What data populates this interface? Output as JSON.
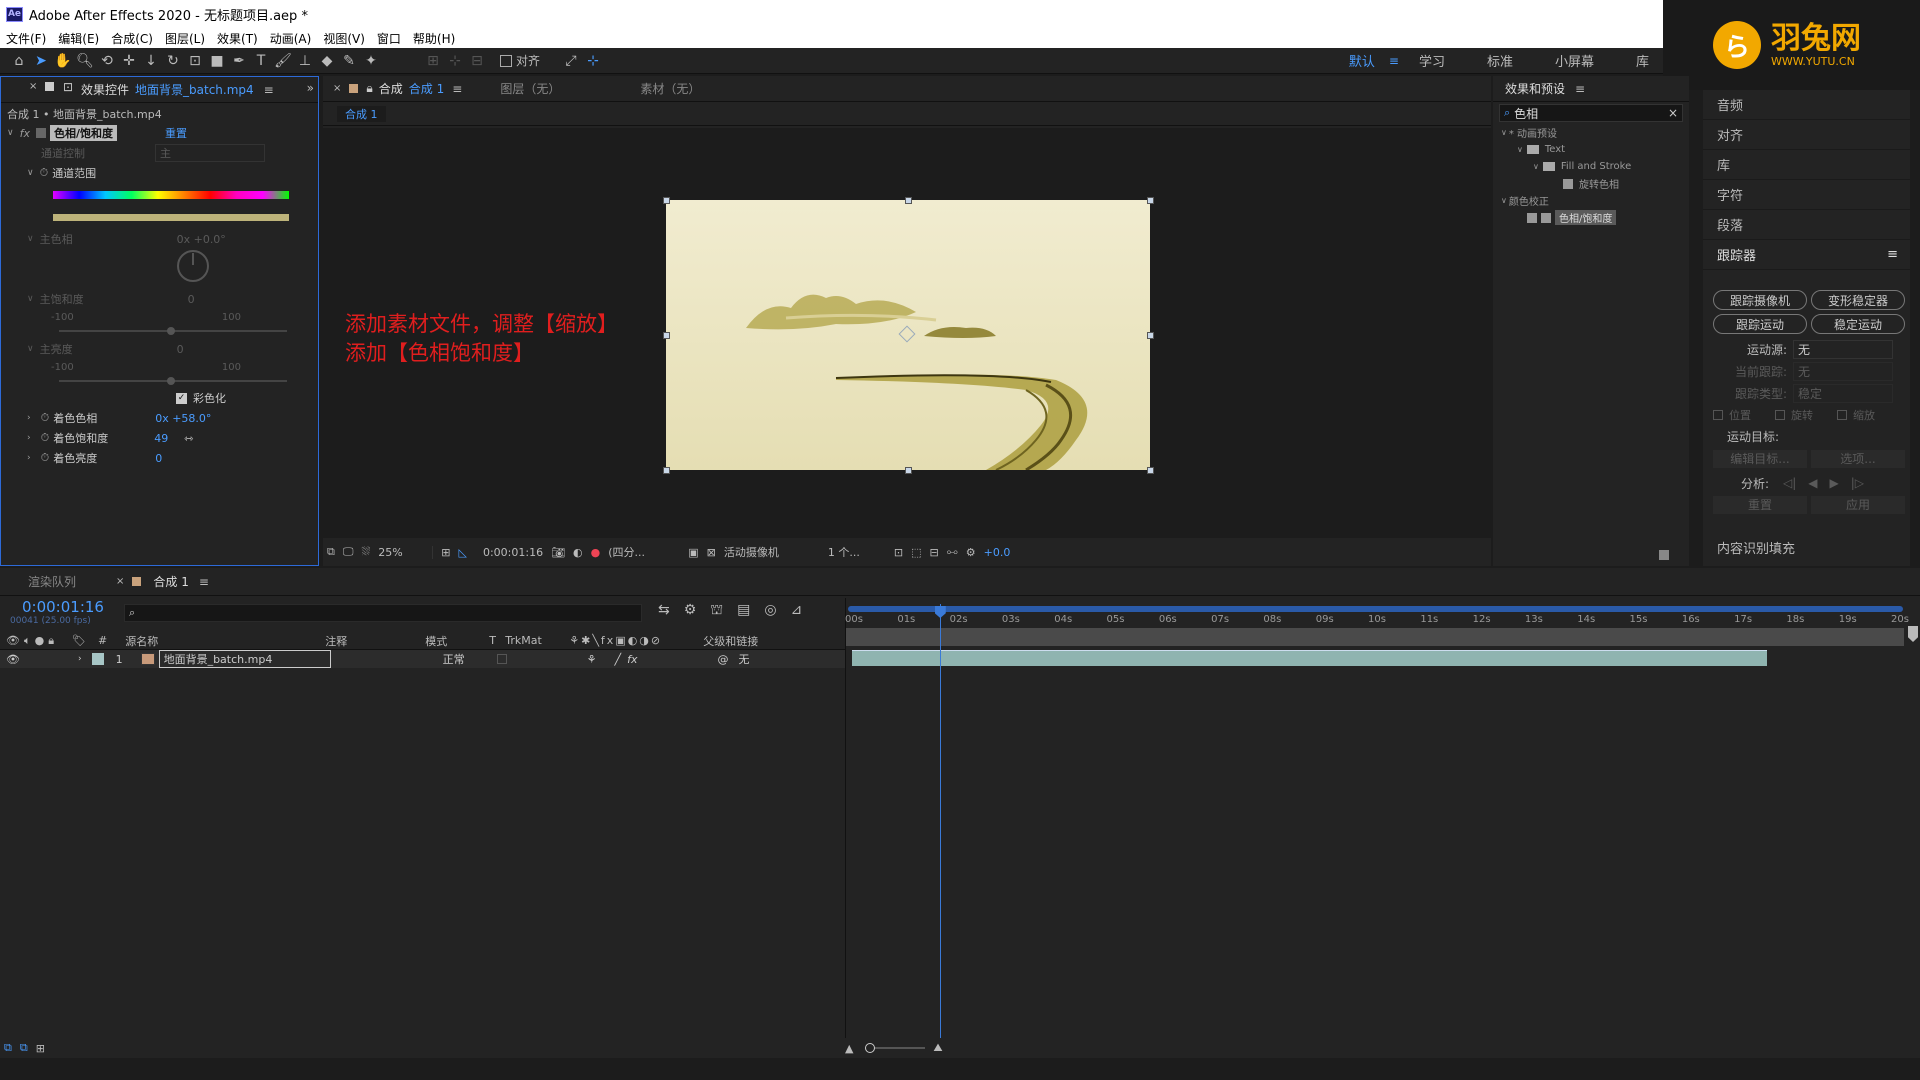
{
  "app": {
    "title": "Adobe After Effects 2020 - 无标题项目.aep *",
    "logo_glyph": "Ae"
  },
  "menu": [
    "文件(F)",
    "编辑(E)",
    "合成(C)",
    "图层(L)",
    "效果(T)",
    "动画(A)",
    "视图(V)",
    "窗口",
    "帮助(H)"
  ],
  "toolbar": {
    "align_label": "对齐",
    "workspaces": [
      "默认",
      "学习",
      "标准",
      "小屏幕",
      "库"
    ]
  },
  "brand": {
    "glyph": "ら",
    "name": "羽兔网",
    "url": "WWW.YUTU.CN",
    "color": "#f2a800"
  },
  "effect_controls": {
    "tab_label": "效果控件",
    "tab_file": "地面背景_batch.mp4",
    "breadcrumb": "合成 1 • 地面背景_batch.mp4",
    "fx_label": "fx",
    "effect_name": "色相/饱和度",
    "reset_label": "重置",
    "channel_control_label": "通道控制",
    "channel_control_value": "主",
    "channel_range_label": "通道范围",
    "master_hue_label": "主色相",
    "master_hue_value": "0x +0.0°",
    "master_sat_label": "主饱和度",
    "master_sat_value": "0",
    "master_light_label": "主亮度",
    "master_light_value": "0",
    "slider_min": "-100",
    "slider_max": "100",
    "colorize_label": "彩色化",
    "colorize_checked": true,
    "colorize_hue_label": "着色色相",
    "colorize_hue_value": "0x +58.0°",
    "colorize_sat_label": "着色饱和度",
    "colorize_sat_value": "49",
    "colorize_light_label": "着色亮度",
    "colorize_light_value": "0"
  },
  "composition": {
    "tab_prefix": "合成",
    "tab_name": "合成 1",
    "layer_tab": "图层（无）",
    "footage_tab": "素材（无）",
    "subtab": "合成 1",
    "annotation_line1": "添加素材文件，调整【缩放】",
    "annotation_line2": "添加【色相饱和度】",
    "zoom": "25%",
    "timecode": "0:00:01:16",
    "resolution": "(四分...",
    "camera": "活动摄像机",
    "views": "1 个...",
    "exposure": "+0.0"
  },
  "effects_presets": {
    "title": "效果和预设",
    "search_value": "色相",
    "tree": [
      {
        "label": "* 动画预设",
        "level": 0
      },
      {
        "label": "Text",
        "level": 1
      },
      {
        "label": "Fill and Stroke",
        "level": 2
      },
      {
        "label": "旋转色相",
        "level": 3
      },
      {
        "label": "颜色校正",
        "level": 0
      },
      {
        "label": "色相/饱和度",
        "level": 1
      }
    ]
  },
  "right_panels": {
    "items": [
      "音频",
      "对齐",
      "库",
      "字符",
      "段落"
    ],
    "tracker_title": "跟踪器",
    "track_camera": "跟踪摄像机",
    "warp_stabilizer": "变形稳定器",
    "track_motion": "跟踪运动",
    "stabilize_motion": "稳定运动",
    "motion_source_label": "运动源:",
    "motion_source_value": "无",
    "current_track_label": "当前跟踪:",
    "current_track_value": "无",
    "track_type_label": "跟踪类型:",
    "track_type_value": "稳定",
    "position_label": "位置",
    "rotation_label": "旋转",
    "scale_label": "缩放",
    "motion_target_label": "运动目标:",
    "edit_target_label": "编辑目标...",
    "options_label": "选项...",
    "analyze_label": "分析:",
    "reset_label": "重置",
    "apply_label": "应用",
    "content_fill": "内容识别填充"
  },
  "timeline": {
    "render_queue_tab": "渲染队列",
    "comp_tab": "合成 1",
    "timecode": "0:00:01:16",
    "frame_info": "00041 (25.00 fps)",
    "search_placeholder": "",
    "col_num": "#",
    "col_source": "源名称",
    "col_comment": "注释",
    "col_mode": "模式",
    "col_t": "T",
    "col_trkmat": "TrkMat",
    "col_parent": "父级和链接",
    "ruler": [
      "00s",
      "01s",
      "02s",
      "03s",
      "04s",
      "05s",
      "06s",
      "07s",
      "08s",
      "09s",
      "10s",
      "11s",
      "12s",
      "13s",
      "14s",
      "15s",
      "16s",
      "17s",
      "18s",
      "19s",
      "20s"
    ],
    "layer": {
      "num": "1",
      "name": "地面背景_batch.mp4",
      "mode": "正常",
      "parent": "无"
    },
    "playhead_seconds": 1.64,
    "duration_seconds": 20,
    "layer_end_seconds": 17.5
  }
}
